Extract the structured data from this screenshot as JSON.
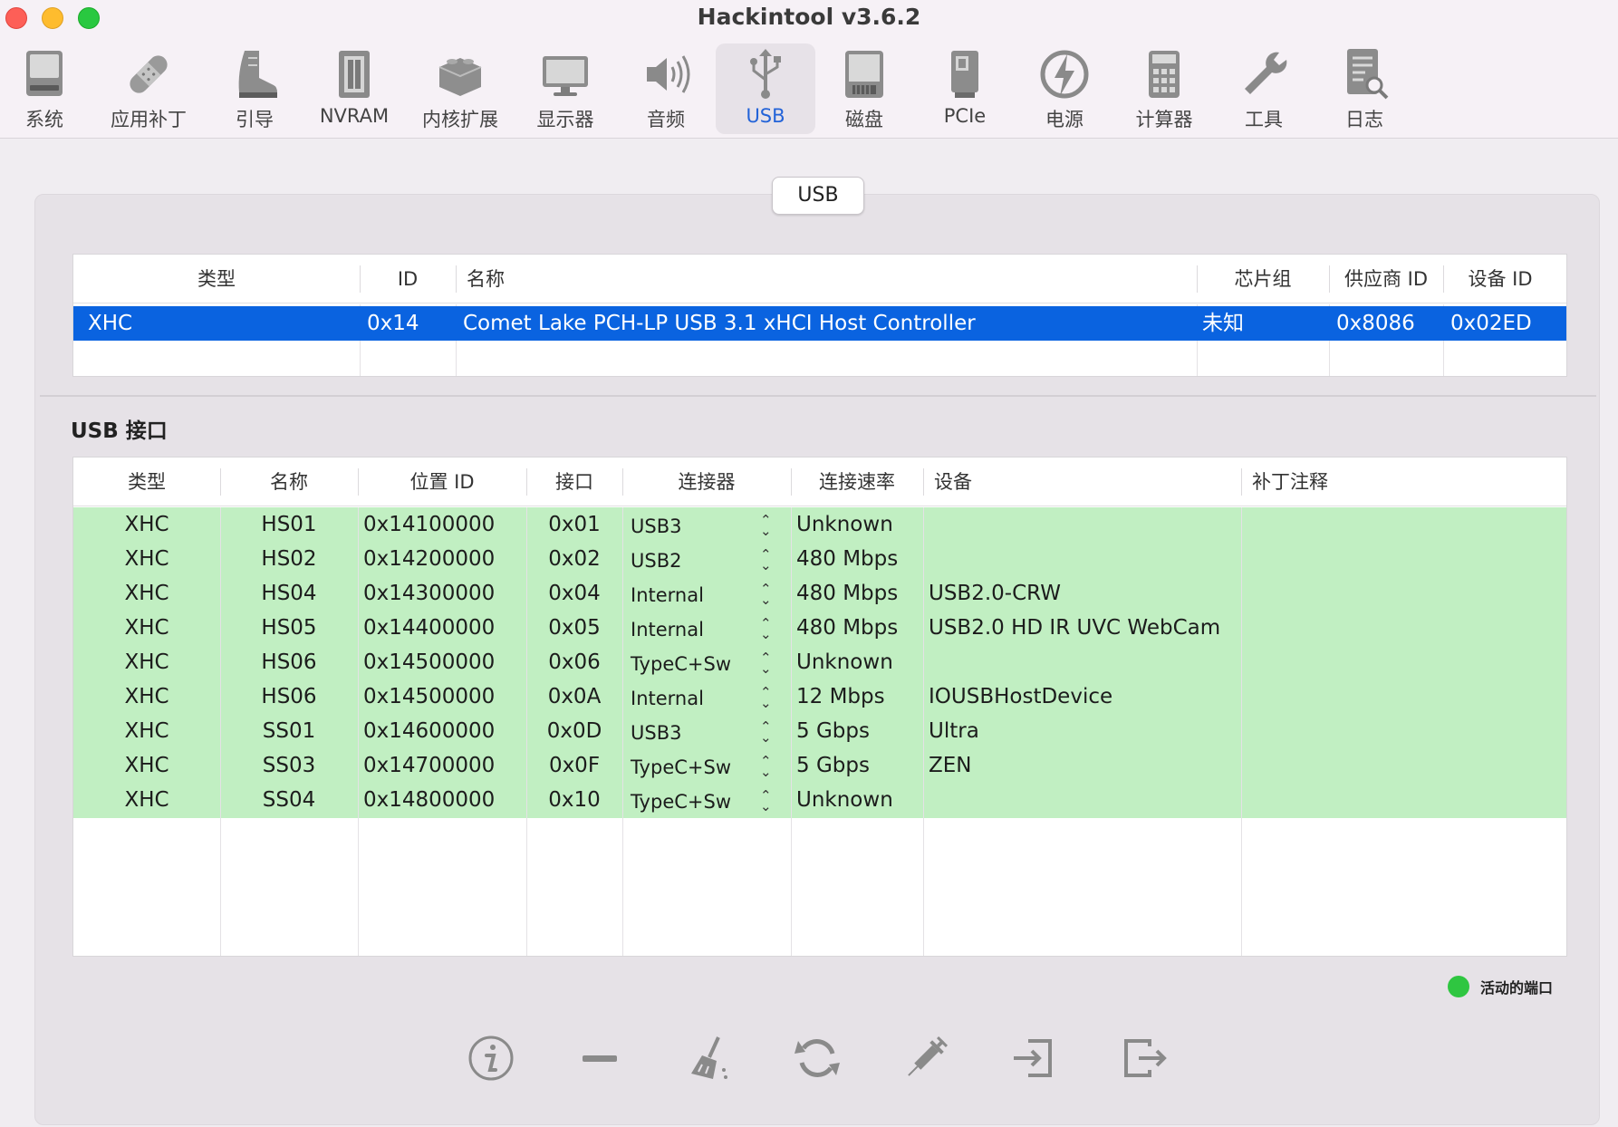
{
  "window": {
    "title": "Hackintool v3.6.2"
  },
  "toolbar": {
    "items": [
      {
        "label": "系统",
        "icon": "system-icon"
      },
      {
        "label": "应用补丁",
        "icon": "bandage-icon"
      },
      {
        "label": "引导",
        "icon": "boot-icon"
      },
      {
        "label": "NVRAM",
        "icon": "nvram-icon"
      },
      {
        "label": "内核扩展",
        "icon": "kext-icon"
      },
      {
        "label": "显示器",
        "icon": "display-icon"
      },
      {
        "label": "音频",
        "icon": "speaker-icon"
      },
      {
        "label": "USB",
        "icon": "usb-icon"
      },
      {
        "label": "磁盘",
        "icon": "disk-icon"
      },
      {
        "label": "PCIe",
        "icon": "pcie-icon"
      },
      {
        "label": "电源",
        "icon": "power-icon"
      },
      {
        "label": "计算器",
        "icon": "calculator-icon"
      },
      {
        "label": "工具",
        "icon": "wrench-icon"
      },
      {
        "label": "日志",
        "icon": "log-icon"
      }
    ],
    "active": "USB",
    "accent": "#2363d8"
  },
  "segment": {
    "label": "USB"
  },
  "controllers": {
    "headers": [
      "类型",
      "ID",
      "名称",
      "芯片组",
      "供应商 ID",
      "设备 ID"
    ],
    "rows": [
      [
        "XHC",
        "0x14",
        "Comet Lake PCH-LP USB 3.1 xHCI Host Controller",
        "未知",
        "0x8086",
        "0x02ED"
      ]
    ],
    "selected_color": "#0a63e0"
  },
  "ports_section": {
    "title": "USB 接口"
  },
  "ports": {
    "headers": [
      "类型",
      "名称",
      "位置 ID",
      "接口",
      "连接器",
      "连接速率",
      "设备",
      "补丁注释"
    ],
    "rows": [
      [
        "XHC",
        "HS01",
        "0x14100000",
        "0x01",
        "USB3",
        "Unknown",
        "",
        ""
      ],
      [
        "XHC",
        "HS02",
        "0x14200000",
        "0x02",
        "USB2",
        "480 Mbps",
        "",
        ""
      ],
      [
        "XHC",
        "HS04",
        "0x14300000",
        "0x04",
        "Internal",
        "480 Mbps",
        "USB2.0-CRW",
        ""
      ],
      [
        "XHC",
        "HS05",
        "0x14400000",
        "0x05",
        "Internal",
        "480 Mbps",
        "USB2.0 HD IR UVC WebCam",
        ""
      ],
      [
        "XHC",
        "HS06",
        "0x14500000",
        "0x06",
        "TypeC+Sw",
        "Unknown",
        "",
        ""
      ],
      [
        "XHC",
        "HS06",
        "0x14500000",
        "0x0A",
        "Internal",
        "12 Mbps",
        "IOUSBHostDevice",
        ""
      ],
      [
        "XHC",
        "SS01",
        "0x14600000",
        "0x0D",
        "USB3",
        "5 Gbps",
        "Ultra",
        ""
      ],
      [
        "XHC",
        "SS03",
        "0x14700000",
        "0x0F",
        "TypeC+Sw",
        "5 Gbps",
        "ZEN",
        ""
      ],
      [
        "XHC",
        "SS04",
        "0x14800000",
        "0x10",
        "TypeC+Sw",
        "Unknown",
        "",
        ""
      ]
    ],
    "active_row_color": "#c1efc2"
  },
  "legend": {
    "label": "活动的端口",
    "color": "#2fc641"
  },
  "bottom_toolbar": [
    "info-icon",
    "minus-icon",
    "broom-icon",
    "refresh-icon",
    "syringe-icon",
    "import-icon",
    "export-icon"
  ]
}
